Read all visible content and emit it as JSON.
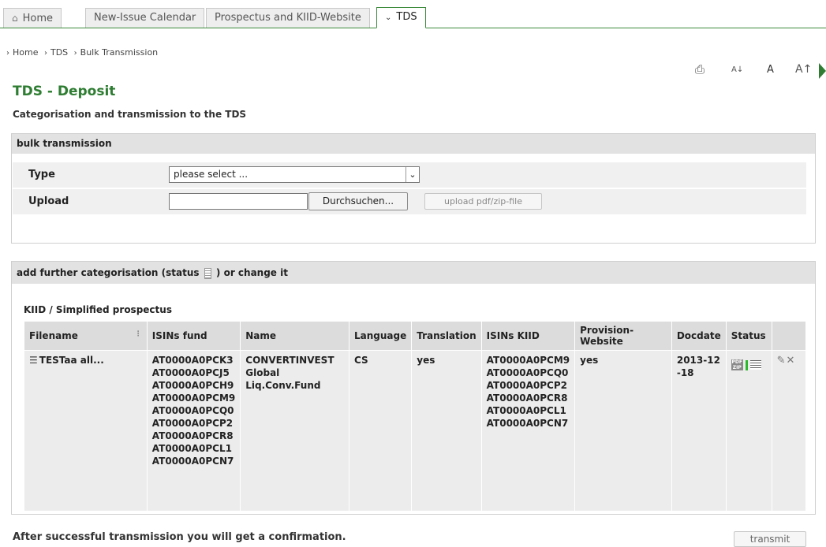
{
  "tabs": [
    {
      "label": "Home",
      "icon": "home-icon"
    },
    {
      "label": "New-Issue Calendar"
    },
    {
      "label": "Prospectus and KIID-Website"
    },
    {
      "label": "TDS",
      "icon": "chevron-down-icon",
      "active": true
    }
  ],
  "breadcrumb": [
    "Home",
    "TDS",
    "Bulk Transmission"
  ],
  "toolbar": {
    "font_small": "A",
    "font_normal": "A",
    "font_large": "A"
  },
  "page": {
    "title": "TDS - Deposit",
    "subtitle": "Categorisation and transmission to the TDS"
  },
  "bulk": {
    "heading": "bulk transmission",
    "type_label": "Type",
    "type_value": "please select ...",
    "upload_label": "Upload",
    "browse_label": "Durchsuchen...",
    "upload_button": "upload pdf/zip-file"
  },
  "categorisation": {
    "heading_pre": "add further categorisation (status",
    "heading_post": ") or change it",
    "caption": "KIID / Simplified prospectus",
    "columns": [
      "Filename",
      "ISINs fund",
      "Name",
      "Language",
      "Translation",
      "ISINs KIID",
      "Provision-Website",
      "Docdate",
      "Status",
      ""
    ],
    "row": {
      "filename": "TESTaa all...",
      "isins_fund": [
        "AT0000A0PCK3",
        "AT0000A0PCJ5",
        "AT0000A0PCH9",
        "AT0000A0PCM9",
        "AT0000A0PCQ0",
        "AT0000A0PCP2",
        "AT0000A0PCR8",
        "AT0000A0PCL1",
        "AT0000A0PCN7"
      ],
      "name_lines": [
        "CONVERTINVEST",
        "Global",
        "Liq.Conv.Fund"
      ],
      "language": "CS",
      "translation": "yes",
      "isins_kiid": [
        "AT0000A0PCM9",
        "AT0000A0PCQ0",
        "AT0000A0PCP2",
        "AT0000A0PCR8",
        "AT0000A0PCL1",
        "AT0000A0PCN7"
      ],
      "provision_website": "yes",
      "docdate_lines": [
        "2013-12",
        "-18"
      ]
    }
  },
  "footer": {
    "message": "After successful transmission you will get a confirmation.",
    "transmit_label": "transmit"
  },
  "colors": {
    "accent": "#2e7d32",
    "panel_header": "#e2e2e2"
  }
}
